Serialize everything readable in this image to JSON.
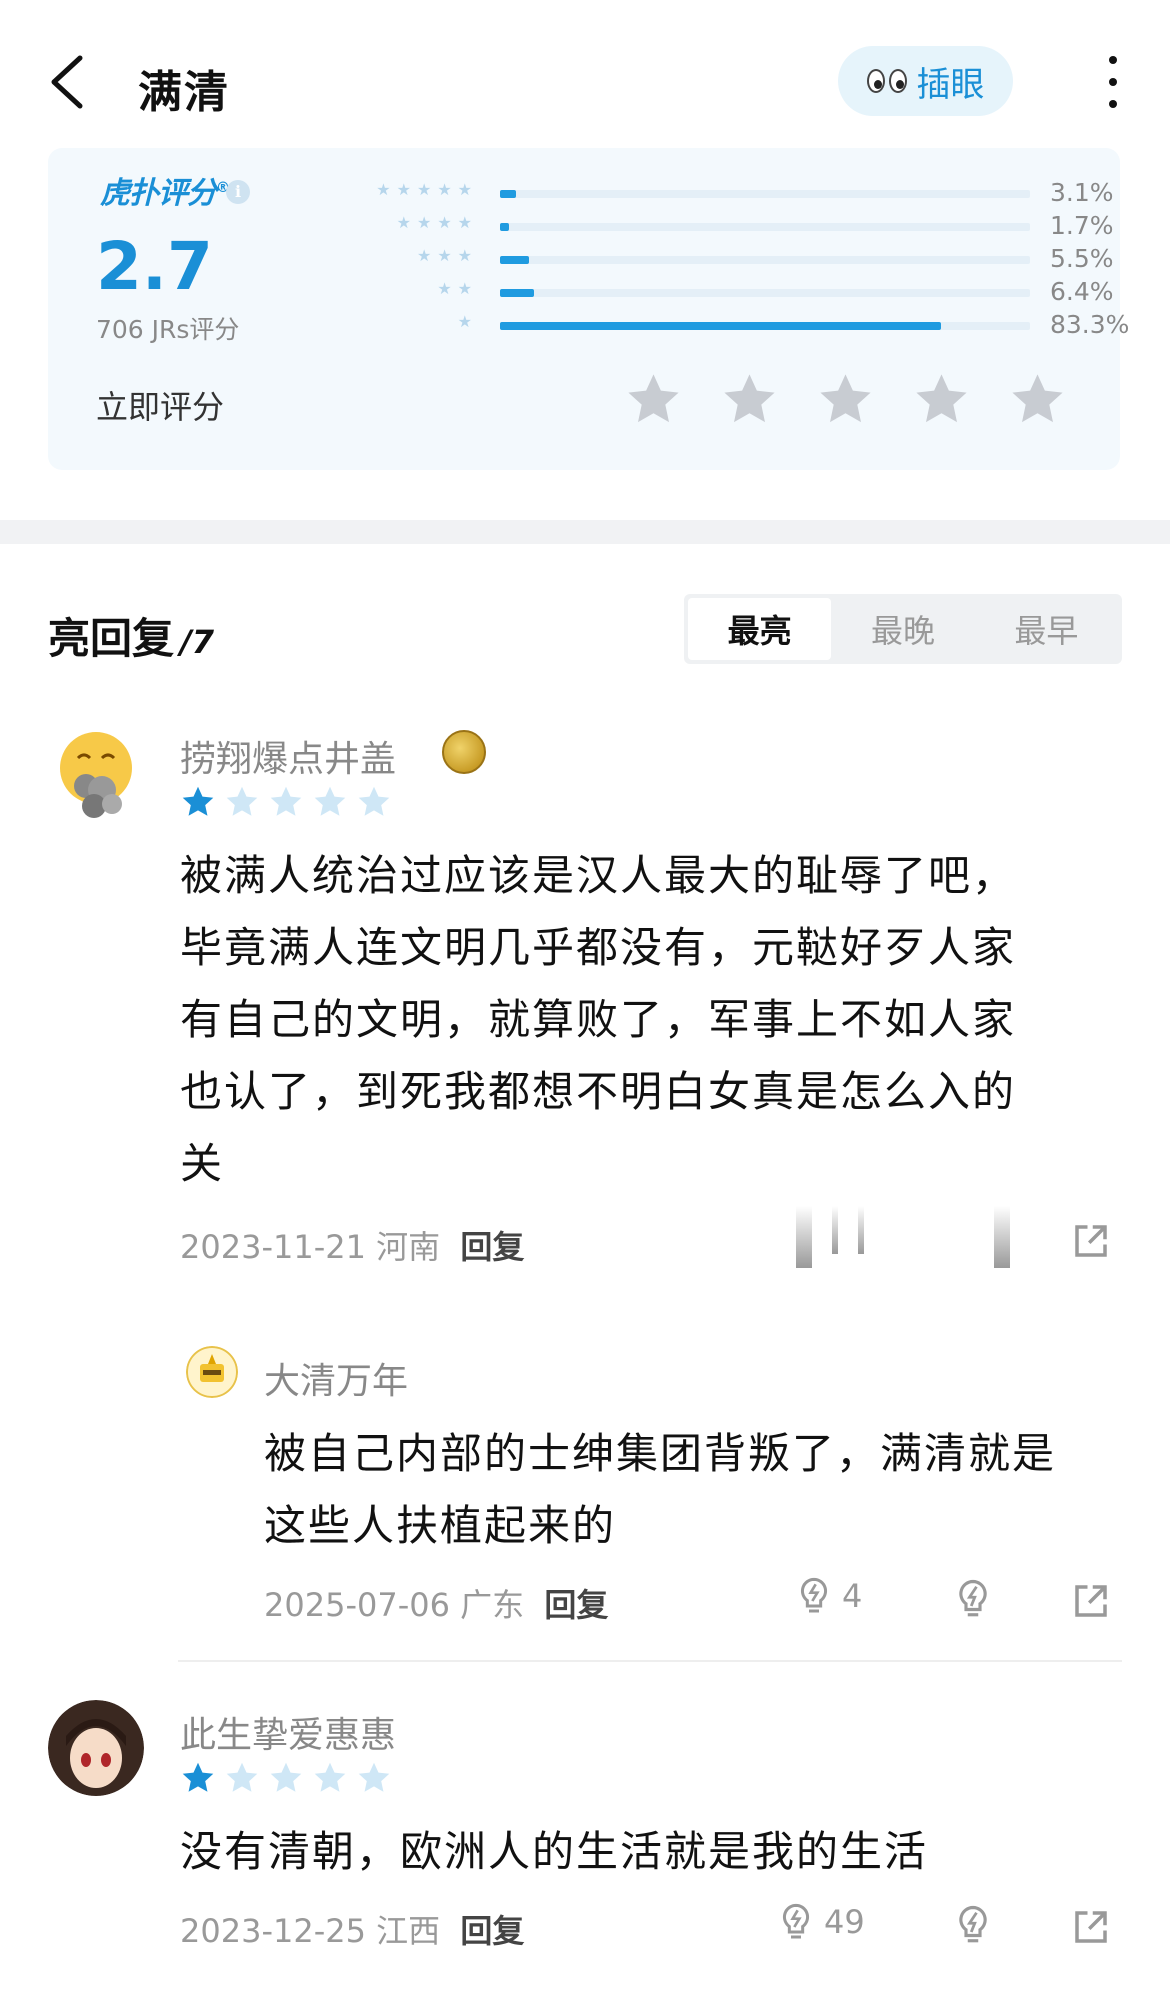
{
  "header": {
    "title": "满清",
    "insert_label": "插眼"
  },
  "rating": {
    "brand": "虎扑评分",
    "score": "2.7",
    "votes": "706 JRs评分",
    "distribution": [
      {
        "stars": "★★★★★",
        "percent": "3.1%",
        "fraction": 0.031
      },
      {
        "stars": "★★★★",
        "percent": "1.7%",
        "fraction": 0.017
      },
      {
        "stars": "★★★",
        "percent": "5.5%",
        "fraction": 0.055
      },
      {
        "stars": "★★",
        "percent": "6.4%",
        "fraction": 0.064
      },
      {
        "stars": "★",
        "percent": "83.3%",
        "fraction": 0.833
      }
    ],
    "rate_now_label": "立即评分"
  },
  "replies": {
    "title": "亮回复",
    "count": "/7",
    "sort_tabs": [
      "最亮",
      "最晚",
      "最早"
    ],
    "active_tab": "最亮"
  },
  "comments": [
    {
      "username": "捞翔爆点井盖",
      "rating": 1,
      "lines": [
        "被满人统治过应该是汉人最大的耻辱了吧，",
        "毕竟满人连文明几乎都没有，元鞑好歹人家",
        "有自己的文明，就算败了，军事上不如人家",
        "也认了，到死我都想不明白女真是怎么入的",
        "关"
      ],
      "date": "2023-11-21",
      "location": "河南",
      "reply_label": "回复"
    },
    {
      "username": "大清万年",
      "lines": [
        "被自己内部的士绅集团背叛了，满清就是",
        "这些人扶植起来的"
      ],
      "date": "2025-07-06",
      "location": "广东",
      "reply_label": "回复",
      "likes": "4"
    },
    {
      "username": "此生挚爱惠惠",
      "rating": 1,
      "lines": [
        "没有清朝，欧洲人的生活就是我的生活"
      ],
      "date": "2023-12-25",
      "location": "江西",
      "reply_label": "回复",
      "likes": "49"
    }
  ],
  "colors": {
    "accent": "#1a8fd6",
    "star_filled": "#1a8fd6",
    "star_empty": "#cfe7f6",
    "rate_star": "#c8ccd2"
  }
}
